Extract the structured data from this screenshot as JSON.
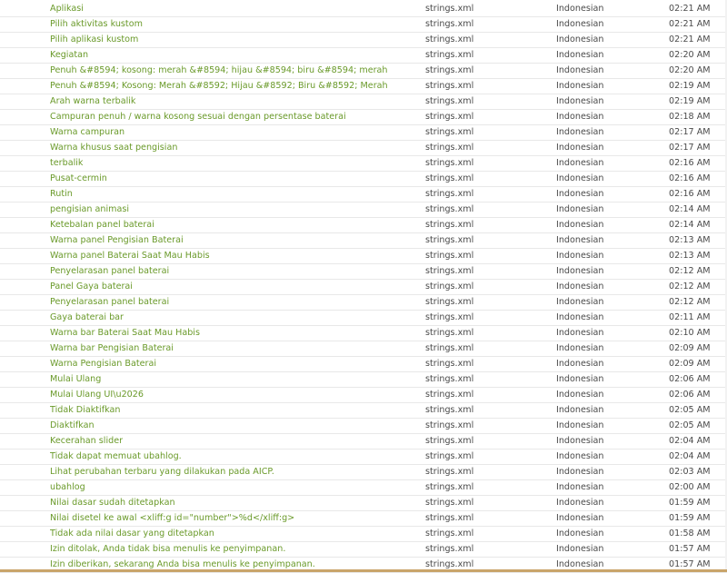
{
  "rows": [
    {
      "string": "Aplikasi",
      "file": "strings.xml",
      "language": "Indonesian",
      "time": "02:21 AM"
    },
    {
      "string": "Pilih aktivitas kustom",
      "file": "strings.xml",
      "language": "Indonesian",
      "time": "02:21 AM"
    },
    {
      "string": "Pilih aplikasi kustom",
      "file": "strings.xml",
      "language": "Indonesian",
      "time": "02:21 AM"
    },
    {
      "string": "Kegiatan",
      "file": "strings.xml",
      "language": "Indonesian",
      "time": "02:20 AM"
    },
    {
      "string": "Penuh &#8594; kosong: merah &#8594; hijau &#8594; biru &#8594; merah",
      "file": "strings.xml",
      "language": "Indonesian",
      "time": "02:20 AM"
    },
    {
      "string": "Penuh &#8594; Kosong: Merah &#8592; Hijau &#8592; Biru &#8592; Merah",
      "file": "strings.xml",
      "language": "Indonesian",
      "time": "02:19 AM"
    },
    {
      "string": "Arah warna terbalik",
      "file": "strings.xml",
      "language": "Indonesian",
      "time": "02:19 AM"
    },
    {
      "string": "Campuran penuh / warna kosong sesuai dengan persentase baterai",
      "file": "strings.xml",
      "language": "Indonesian",
      "time": "02:18 AM"
    },
    {
      "string": "Warna campuran",
      "file": "strings.xml",
      "language": "Indonesian",
      "time": "02:17 AM"
    },
    {
      "string": "Warna khusus saat pengisian",
      "file": "strings.xml",
      "language": "Indonesian",
      "time": "02:17 AM"
    },
    {
      "string": "terbalik",
      "file": "strings.xml",
      "language": "Indonesian",
      "time": "02:16 AM"
    },
    {
      "string": "Pusat-cermin",
      "file": "strings.xml",
      "language": "Indonesian",
      "time": "02:16 AM"
    },
    {
      "string": "Rutin",
      "file": "strings.xml",
      "language": "Indonesian",
      "time": "02:16 AM"
    },
    {
      "string": "pengisian animasi",
      "file": "strings.xml",
      "language": "Indonesian",
      "time": "02:14 AM"
    },
    {
      "string": "Ketebalan panel baterai",
      "file": "strings.xml",
      "language": "Indonesian",
      "time": "02:14 AM"
    },
    {
      "string": "Warna panel Pengisian Baterai",
      "file": "strings.xml",
      "language": "Indonesian",
      "time": "02:13 AM"
    },
    {
      "string": "Warna panel Baterai Saat Mau Habis",
      "file": "strings.xml",
      "language": "Indonesian",
      "time": "02:13 AM"
    },
    {
      "string": "Penyelarasan panel baterai",
      "file": "strings.xml",
      "language": "Indonesian",
      "time": "02:12 AM"
    },
    {
      "string": "Panel Gaya baterai",
      "file": "strings.xml",
      "language": "Indonesian",
      "time": "02:12 AM"
    },
    {
      "string": "Penyelarasan panel baterai",
      "file": "strings.xml",
      "language": "Indonesian",
      "time": "02:12 AM"
    },
    {
      "string": "Gaya baterai bar",
      "file": "strings.xml",
      "language": "Indonesian",
      "time": "02:11 AM"
    },
    {
      "string": "Warna bar Baterai Saat Mau Habis",
      "file": "strings.xml",
      "language": "Indonesian",
      "time": "02:10 AM"
    },
    {
      "string": "Warna bar Pengisian Baterai",
      "file": "strings.xml",
      "language": "Indonesian",
      "time": "02:09 AM"
    },
    {
      "string": "Warna Pengisian Baterai",
      "file": "strings.xml",
      "language": "Indonesian",
      "time": "02:09 AM"
    },
    {
      "string": "Mulai Ulang",
      "file": "strings.xml",
      "language": "Indonesian",
      "time": "02:06 AM"
    },
    {
      "string": "Mulai Ulang UI\\u2026",
      "file": "strings.xml",
      "language": "Indonesian",
      "time": "02:06 AM"
    },
    {
      "string": "Tidak Diaktifkan",
      "file": "strings.xml",
      "language": "Indonesian",
      "time": "02:05 AM"
    },
    {
      "string": "Diaktifkan",
      "file": "strings.xml",
      "language": "Indonesian",
      "time": "02:05 AM"
    },
    {
      "string": "Kecerahan slider",
      "file": "strings.xml",
      "language": "Indonesian",
      "time": "02:04 AM"
    },
    {
      "string": "Tidak dapat memuat ubahlog.",
      "file": "strings.xml",
      "language": "Indonesian",
      "time": "02:04 AM"
    },
    {
      "string": "Lihat perubahan terbaru yang dilakukan pada AICP.",
      "file": "strings.xml",
      "language": "Indonesian",
      "time": "02:03 AM"
    },
    {
      "string": "ubahlog",
      "file": "strings.xml",
      "language": "Indonesian",
      "time": "02:00 AM"
    },
    {
      "string": "Nilai dasar sudah ditetapkan",
      "file": "strings.xml",
      "language": "Indonesian",
      "time": "01:59 AM"
    },
    {
      "string": "Nilai disetel ke awal <xliff:g id=\"number\">%d</xliff:g>",
      "file": "strings.xml",
      "language": "Indonesian",
      "time": "01:59 AM"
    },
    {
      "string": "Tidak ada nilai dasar yang ditetapkan",
      "file": "strings.xml",
      "language": "Indonesian",
      "time": "01:58 AM"
    },
    {
      "string": "Izin ditolak, Anda tidak bisa menulis ke penyimpanan.",
      "file": "strings.xml",
      "language": "Indonesian",
      "time": "01:57 AM"
    },
    {
      "string": "Izin diberikan, sekarang Anda bisa menulis ke penyimpanan.",
      "file": "strings.xml",
      "language": "Indonesian",
      "time": "01:57 AM"
    }
  ],
  "colors": {
    "link_green": "#6a9a2a",
    "text_gray": "#4a4a4a",
    "row_border": "#e8e8e8",
    "bottom_strip": "#c9a46a"
  }
}
